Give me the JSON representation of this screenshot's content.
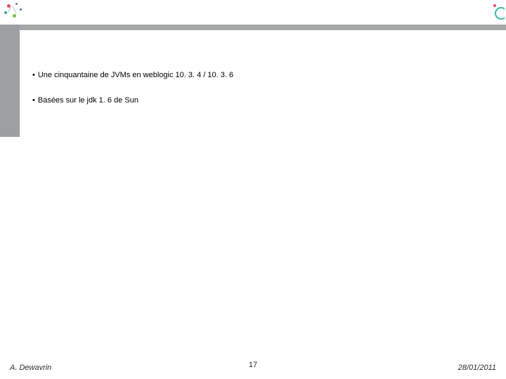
{
  "bullets": [
    "Une cinquantaine de JVMs en weblogic 10. 3. 4 / 10. 3. 6",
    "Basées sur le jdk 1. 6 de Sun"
  ],
  "footer": {
    "author": "A. Dewavrin",
    "page": "17",
    "date": "28/01/2011"
  }
}
